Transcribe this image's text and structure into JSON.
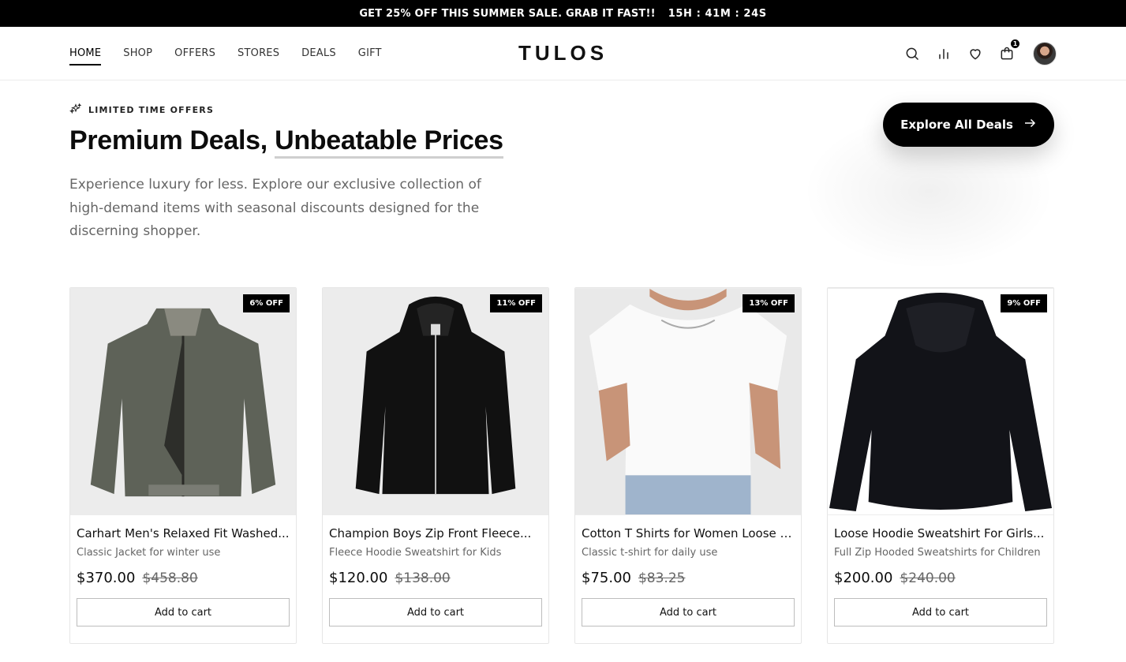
{
  "promo": {
    "text": "GET 25% OFF THIS SUMMER SALE. GRAB IT FAST!!",
    "timer": "15H : 41M : 24S"
  },
  "nav": {
    "items": [
      {
        "label": "HOME"
      },
      {
        "label": "SHOP"
      },
      {
        "label": "OFFERS"
      },
      {
        "label": "STORES"
      },
      {
        "label": "DEALS"
      },
      {
        "label": "GIFT"
      }
    ],
    "active": "HOME"
  },
  "brand": {
    "logo": "TULOS"
  },
  "header_icons": [
    "search-icon",
    "chart-icon",
    "heart-icon",
    "bag-icon"
  ],
  "cart_count": "1",
  "hero": {
    "eyebrow": "LIMITED TIME OFFERS",
    "title_part1": "Premium Deals,",
    "title_part2": "Unbeatable Prices",
    "description": "Experience luxury for less. Explore our exclusive collection of high-demand items with seasonal discounts designed for the discerning shopper.",
    "cta": "Explore All Deals"
  },
  "products": [
    {
      "badge": "6% OFF",
      "name": "Carhart Men's Relaxed Fit Washed...",
      "subtitle": "Classic Jacket for winter use",
      "price": "$370.00",
      "old_price": "$458.80",
      "cta": "Add to cart"
    },
    {
      "badge": "11% OFF",
      "name": "Champion Boys Zip Front Fleece...",
      "subtitle": "Fleece Hoodie Sweatshirt for Kids",
      "price": "$120.00",
      "old_price": "$138.00",
      "cta": "Add to cart"
    },
    {
      "badge": "13% OFF",
      "name": "Cotton T Shirts for Women Loose Fit...",
      "subtitle": "Classic t-shirt for daily use",
      "price": "$75.00",
      "old_price": "$83.25",
      "cta": "Add to cart"
    },
    {
      "badge": "9% OFF",
      "name": "Loose Hoodie Sweatshirt For Girls...",
      "subtitle": "Full Zip Hooded Sweatshirts for Children",
      "price": "$200.00",
      "old_price": "$240.00",
      "cta": "Add to cart"
    }
  ],
  "colors": {
    "primary": "#000000",
    "background": "#ffffff",
    "image_bg": "#ececec",
    "muted_text": "#666666"
  }
}
